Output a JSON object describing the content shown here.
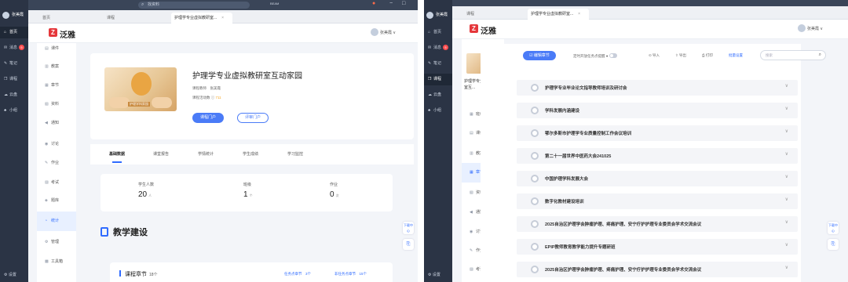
{
  "window": {
    "search_placeholder": "找资料",
    "mini_label": "BEAM",
    "controls": [
      "−",
      "□"
    ]
  },
  "left": {
    "tabs": [
      {
        "label": "首页",
        "active": false
      },
      {
        "label": "课程",
        "active": false
      },
      {
        "label": "护理学专业虚拟教研室...",
        "active": true,
        "close": "×"
      }
    ],
    "user_name": "张美霞",
    "dark_nav": [
      {
        "icon": "⌂",
        "label": "首页",
        "active": true
      },
      {
        "icon": "✉",
        "label": "消息",
        "badge": "5"
      },
      {
        "icon": "✎",
        "label": "笔记"
      },
      {
        "icon": "❒",
        "label": "课程"
      },
      {
        "icon": "☁",
        "label": "云盘"
      },
      {
        "icon": "♣",
        "label": "小组"
      }
    ],
    "settings_label": "设置",
    "brand": "泛雅",
    "header_user": "张美霞 ∨",
    "sub_nav": [
      {
        "icon": "▤",
        "label": "课件"
      },
      {
        "icon": "▥",
        "label": "教案"
      },
      {
        "icon": "▦",
        "label": "章节"
      },
      {
        "icon": "▧",
        "label": "资料"
      },
      {
        "icon": "◀",
        "label": "通知"
      },
      {
        "icon": "◉",
        "label": "讨论"
      },
      {
        "icon": "✎",
        "label": "作业"
      },
      {
        "icon": "▨",
        "label": "考试"
      },
      {
        "icon": "◈",
        "label": "题库"
      },
      {
        "icon": "◔",
        "label": "统计",
        "active": true
      },
      {
        "icon": "⚙",
        "label": "管理"
      },
      {
        "icon": "▩",
        "label": "工具箱"
      }
    ],
    "course": {
      "title": "护理学专业虚拟教研室互动家园",
      "cover_caption": "护理学科家园",
      "teacher_label": "课程教师",
      "teacher": "张美霞",
      "activity_label": "课程活动数 ⓘ",
      "activity_count": "711",
      "btn_portal": "课程门户",
      "btn_eval": "评审门户"
    },
    "sub_tabs": [
      {
        "label": "基础数据",
        "active": true
      },
      {
        "label": "课堂报告"
      },
      {
        "label": "学情统计"
      },
      {
        "label": "学生成绩"
      },
      {
        "label": "学习监控"
      }
    ],
    "stats": [
      {
        "label": "学生人数",
        "value": "20",
        "unit": "人"
      },
      {
        "label": "班级",
        "value": "1",
        "unit": "个"
      },
      {
        "label": "作业",
        "value": "0",
        "unit": "次"
      }
    ],
    "section_title": "教学建设",
    "chapter": {
      "title": "课程章节",
      "count": "18个",
      "link1": "任务点章节　3个",
      "link2": "非任务点章节　15个"
    },
    "float_labels": [
      "下载中心",
      "⎘"
    ]
  },
  "right": {
    "tabs": [
      {
        "label": "课程",
        "active": false
      },
      {
        "label": "护理学专业虚拟教研室...",
        "active": true,
        "close": "×"
      }
    ],
    "user_name": "张美霞",
    "dark_nav": [
      {
        "icon": "⌂",
        "label": "首页"
      },
      {
        "icon": "✉",
        "label": "消息",
        "badge": "5"
      },
      {
        "icon": "✎",
        "label": "笔记"
      },
      {
        "icon": "❒",
        "label": "课程",
        "active": true
      },
      {
        "icon": "☁",
        "label": "云盘"
      },
      {
        "icon": "♣",
        "label": "小组"
      }
    ],
    "settings_label": "设置",
    "brand": "泛雅",
    "header_user": "张美霞 ∨",
    "course_name": "护理学专业虚拟教研室互...",
    "sub_nav": [
      {
        "icon": "▦",
        "label": "班级活动"
      },
      {
        "icon": "▤",
        "label": "课件"
      },
      {
        "icon": "▥",
        "label": "教案"
      },
      {
        "icon": "▦",
        "label": "章节",
        "active": true
      },
      {
        "icon": "▧",
        "label": "资料"
      },
      {
        "icon": "◀",
        "label": "通知"
      },
      {
        "icon": "◉",
        "label": "讨论"
      },
      {
        "icon": "✎",
        "label": "作业"
      },
      {
        "icon": "▨",
        "label": "考试"
      }
    ],
    "toolbar": {
      "edit_btn": "☑ 编辑章节",
      "task_toggle": "定时开放任务点提醒 ●",
      "import": "⊙ 导入",
      "export": "⇧ 导出",
      "print": "⎙ 打印",
      "batch": "批量设置",
      "search_placeholder": "搜索"
    },
    "chapters": [
      "护理学专业毕业论文指导教师培训及研讨会",
      "学科发展内涵建设",
      "鄂尔多斯市护理学专业质量控制工作会议培训",
      "第二十一届世界中医药大会241025",
      "中国护理学科发展大会",
      "数字化教材建设培训",
      "2025自治区护理学会肿瘤护理、疼痛护理、安宁疗护护理专业委员会学术交流会议",
      "EPIP教师教育教学能力提升专题研班",
      "2025自治区护理学会肿瘤护理、疼痛护理、安宁疗护护理专业委员会学术交流会议"
    ],
    "chevron": "∨",
    "float_labels": [
      "下载中心",
      "⎘"
    ]
  }
}
